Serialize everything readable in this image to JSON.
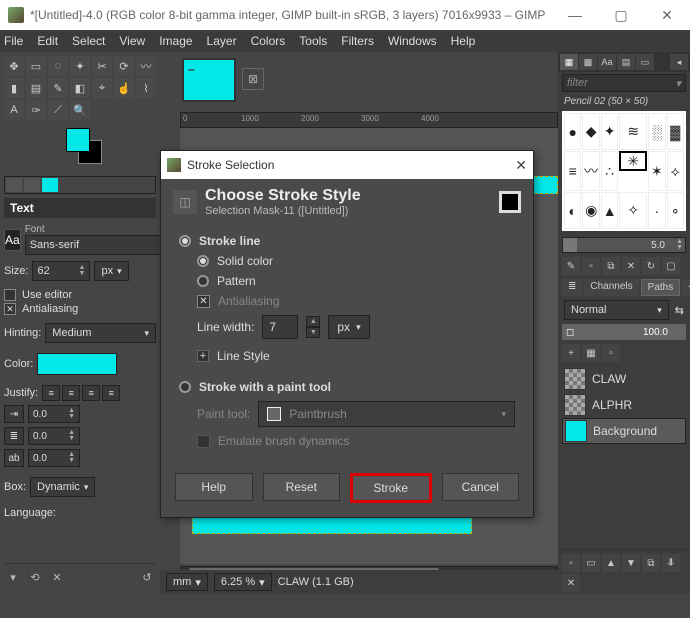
{
  "window": {
    "title": "*[Untitled]-4.0 (RGB color 8-bit gamma integer, GIMP built-in sRGB, 3 layers) 7016x9933 – GIMP"
  },
  "menubar": [
    "File",
    "Edit",
    "Select",
    "View",
    "Image",
    "Layer",
    "Colors",
    "Tools",
    "Filters",
    "Windows",
    "Help"
  ],
  "ruler_ticks": [
    "0",
    "1000",
    "2000",
    "3000",
    "4000"
  ],
  "left": {
    "text_panel_title": "Text",
    "font_label": "Font",
    "font_value": "Sans-serif",
    "size_label": "Size:",
    "size_value": "62",
    "size_unit": "px",
    "use_editor": "Use editor",
    "antialiasing": "Antialiasing",
    "hinting_label": "Hinting:",
    "hinting_value": "Medium",
    "color_label": "Color:",
    "justify_label": "Justify:",
    "indent_values": [
      "0.0",
      "0.0",
      "0.0"
    ],
    "box_label": "Box:",
    "box_value": "Dynamic",
    "language_label": "Language:"
  },
  "right": {
    "filter_placeholder": "filter",
    "brush_name": "Pencil 02 (50 × 50)",
    "brush_size": "5.0",
    "tabs": {
      "channels": "Channels",
      "paths": "Paths"
    },
    "mode_label": "Normal",
    "opacity": "100.0",
    "layers": [
      {
        "name": "CLAW",
        "thumb": "check"
      },
      {
        "name": "ALPHR",
        "thumb": "check"
      },
      {
        "name": "Background",
        "thumb": "cyan"
      }
    ]
  },
  "status": {
    "unit": "mm",
    "zoom": "6.25 %",
    "info": "CLAW (1.1 GB)"
  },
  "dialog": {
    "title": "Stroke Selection",
    "heading": "Choose Stroke Style",
    "subheading": "Selection Mask-11 ([Untitled])",
    "stroke_line": "Stroke line",
    "solid_color": "Solid color",
    "pattern": "Pattern",
    "antialiasing": "Antialiasing",
    "line_width_label": "Line width:",
    "line_width_value": "7",
    "line_width_unit": "px",
    "line_style": "Line Style",
    "stroke_paint": "Stroke with a paint tool",
    "paint_tool_label": "Paint tool:",
    "paint_tool_value": "Paintbrush",
    "emulate": "Emulate brush dynamics",
    "btn_help": "Help",
    "btn_reset": "Reset",
    "btn_stroke": "Stroke",
    "btn_cancel": "Cancel"
  }
}
